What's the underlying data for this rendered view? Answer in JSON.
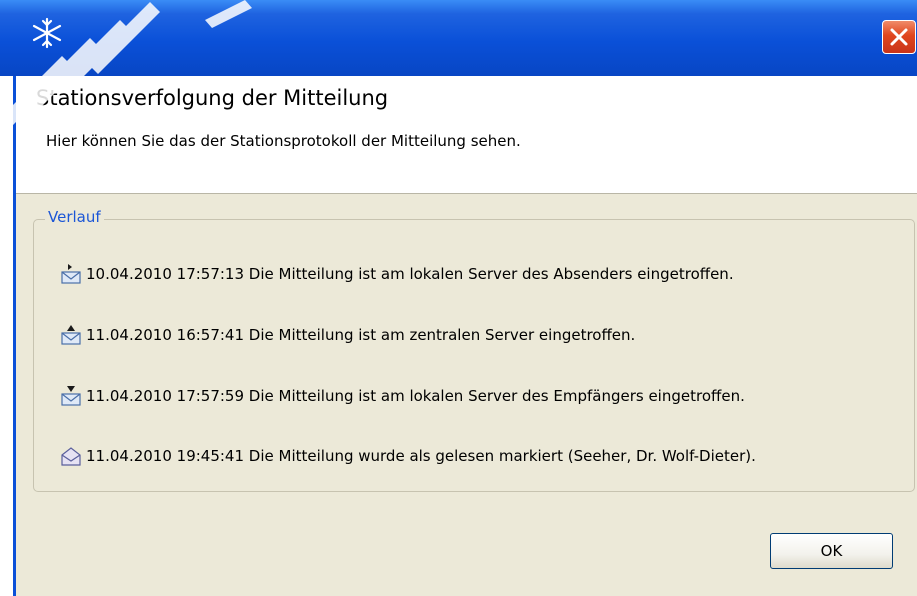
{
  "window": {
    "icon": "snowflake-icon",
    "close_icon": "close-icon"
  },
  "header": {
    "title": "Stationsverfolgung der Mitteilung",
    "description": "Hier können Sie das der Stationsprotokoll der Mitteilung sehen."
  },
  "history": {
    "legend": "Verlauf",
    "entries": [
      {
        "icon": "envelope-sent-icon",
        "text": "10.04.2010 17:57:13 Die Mitteilung ist am lokalen Server des Absenders eingetroffen."
      },
      {
        "icon": "envelope-up-icon",
        "text": "11.04.2010 16:57:41 Die Mitteilung ist am zentralen Server eingetroffen."
      },
      {
        "icon": "envelope-down-icon",
        "text": "11.04.2010 17:57:59 Die Mitteilung ist am lokalen Server des Empfängers eingetroffen."
      },
      {
        "icon": "envelope-open-icon",
        "text": "11.04.2010 19:45:41 Die Mitteilung wurde als gelesen markiert (Seeher, Dr. Wolf-Dieter)."
      }
    ]
  },
  "buttons": {
    "ok_label": "OK"
  },
  "colors": {
    "titlebar": "#0a50d8",
    "close_button": "#e0461e",
    "legend_text": "#1c56d6",
    "dialog_background": "#ece9d8"
  }
}
